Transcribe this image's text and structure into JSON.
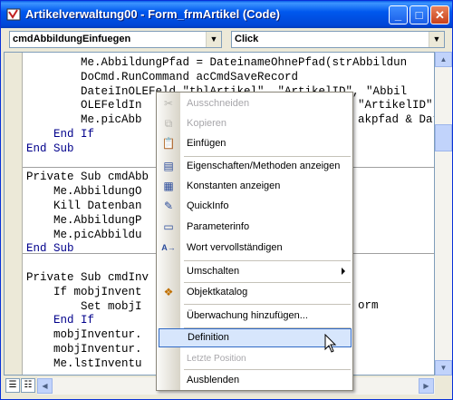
{
  "window": {
    "title": "Artikelverwaltung00 - Form_frmArtikel (Code)",
    "minimize": "_",
    "maximize": "□",
    "close": "✕"
  },
  "combos": {
    "object": "cmdAbbildungEinfuegen",
    "procedure": "Click"
  },
  "code_lines": [
    "        Me.AbbildungPfad = DateinameOhnePfad(strAbbildun",
    "        DoCmd.RunCommand acCmdSaveRecord",
    "        DateiInOLEFeld \"tblArtikel\", \"ArtikelID\", \"Abbil",
    "        OLEFeldIn",
    "        Me.picAbb",
    "    End If",
    "End Sub",
    "",
    "Private Sub cmdAbb",
    "    Me.AbbildungO",
    "    Kill Datenban",
    "    Me.AbbildungP",
    "    Me.picAbbildu",
    "End Sub",
    "",
    "Private Sub cmdInv",
    "    If mobjInvent",
    "        Set mobjI",
    "    End If",
    "    mobjInventur.",
    "    mobjInventur.",
    "    Me.lstInventu"
  ],
  "code_tails": {
    "line4": "\"ArtikelID\", \"Abbil",
    "line5": "akpfad & Dat",
    "line18": "orm"
  },
  "menu": {
    "items": [
      {
        "label": "Ausschneiden",
        "icon": "cut-icon",
        "enabled": false
      },
      {
        "label": "Kopieren",
        "icon": "copy-icon",
        "enabled": false
      },
      {
        "label": "Einfügen",
        "icon": "paste-icon",
        "enabled": true
      },
      {
        "label": "Eigenschaften/Methoden anzeigen",
        "icon": "properties-methods-icon",
        "enabled": true
      },
      {
        "label": "Konstanten anzeigen",
        "icon": "constants-icon",
        "enabled": true
      },
      {
        "label": "QuickInfo",
        "icon": "quickinfo-icon",
        "enabled": true
      },
      {
        "label": "Parameterinfo",
        "icon": "parameterinfo-icon",
        "enabled": true
      },
      {
        "label": "Wort vervollständigen",
        "icon": "complete-word-icon",
        "enabled": true
      },
      {
        "label": "Umschalten",
        "icon": "",
        "enabled": true,
        "submenu": true
      },
      {
        "label": "Objektkatalog",
        "icon": "object-browser-icon",
        "enabled": true
      },
      {
        "label": "Überwachung hinzufügen...",
        "icon": "",
        "enabled": true
      },
      {
        "label": "Definition",
        "icon": "",
        "enabled": true,
        "highlighted": true
      },
      {
        "label": "Letzte Position",
        "icon": "",
        "enabled": false
      },
      {
        "label": "Ausblenden",
        "icon": "",
        "enabled": true
      }
    ]
  },
  "colors": {
    "keyword": "#00008b",
    "highlight_bg": "#d7e6fc",
    "highlight_border": "#316ac5",
    "title_bar": "#0054e3"
  }
}
